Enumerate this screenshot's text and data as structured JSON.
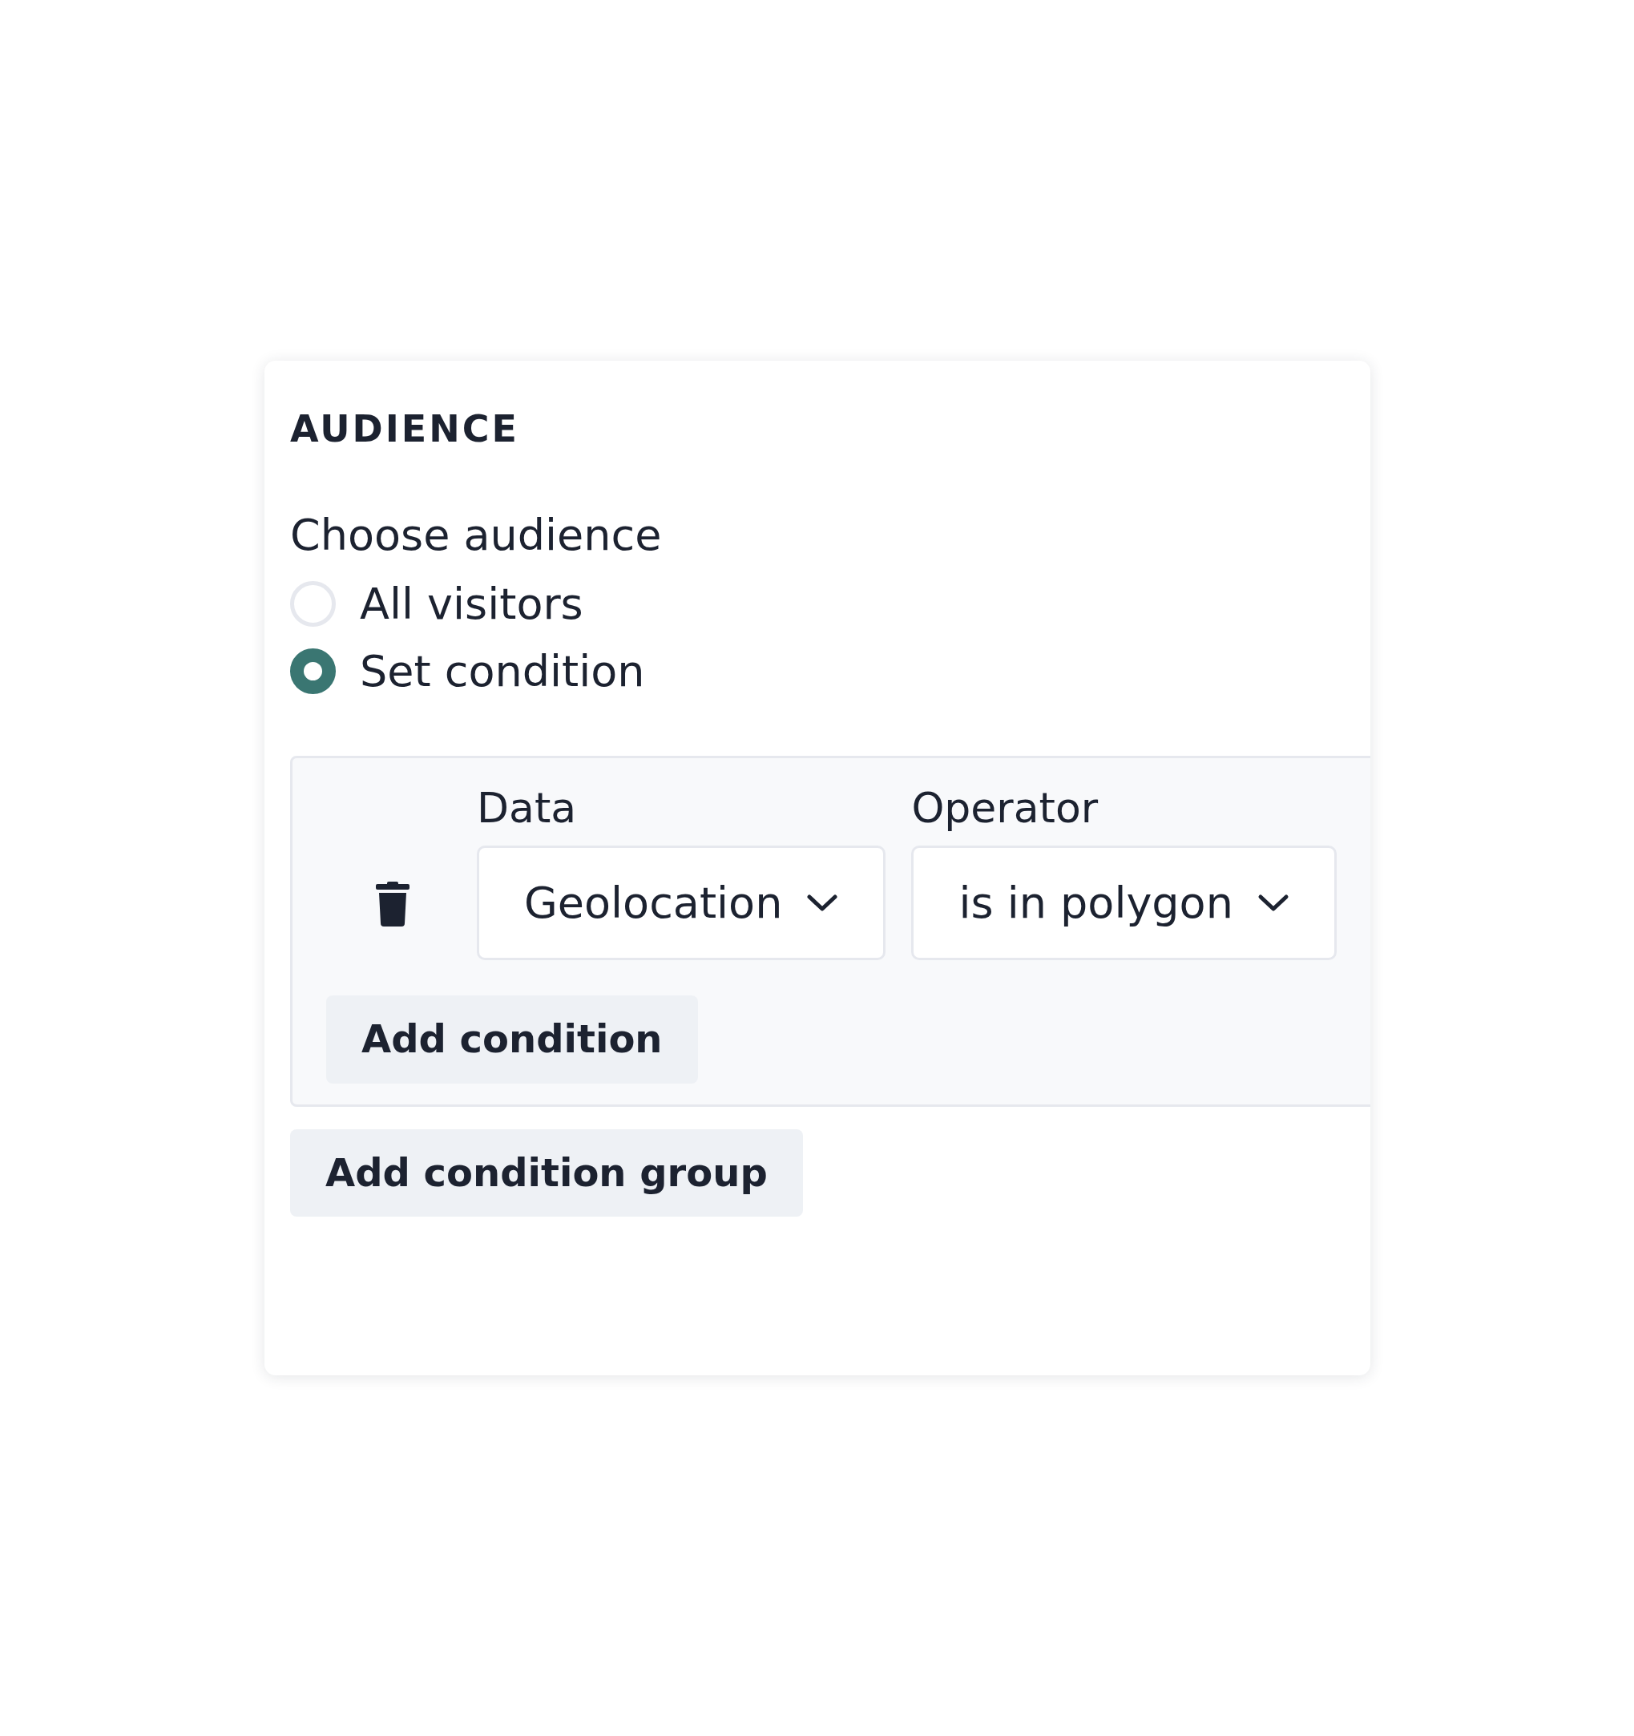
{
  "section_title": "AUDIENCE",
  "prompt": "Choose audience",
  "options": [
    {
      "label": "All visitors",
      "selected": false
    },
    {
      "label": "Set condition",
      "selected": true
    }
  ],
  "condition_group": {
    "fields": [
      {
        "label": "Data",
        "value": "Geolocation"
      },
      {
        "label": "Operator",
        "value": "is in polygon"
      }
    ],
    "add_button": "Add condition"
  },
  "add_group_button": "Add condition group"
}
